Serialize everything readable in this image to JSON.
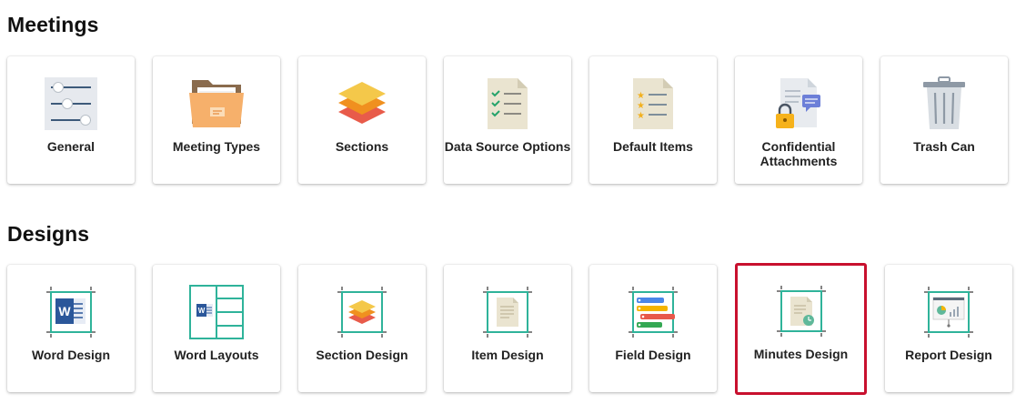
{
  "meetings": {
    "title": "Meetings",
    "items": [
      {
        "label": "General",
        "icon": "sliders-icon"
      },
      {
        "label": "Meeting Types",
        "icon": "folder-icon"
      },
      {
        "label": "Sections",
        "icon": "layers-icon"
      },
      {
        "label": "Data Source Options",
        "icon": "checklist-document-icon"
      },
      {
        "label": "Default Items",
        "icon": "starred-list-document-icon"
      },
      {
        "label": "Confidential Attachments",
        "icon": "locked-document-icon"
      },
      {
        "label": "Trash Can",
        "icon": "trash-can-icon"
      }
    ]
  },
  "designs": {
    "title": "Designs",
    "items": [
      {
        "label": "Word Design",
        "icon": "word-design-icon"
      },
      {
        "label": "Word Layouts",
        "icon": "word-layouts-icon"
      },
      {
        "label": "Section Design",
        "icon": "section-design-icon"
      },
      {
        "label": "Item Design",
        "icon": "item-design-icon"
      },
      {
        "label": "Field Design",
        "icon": "field-design-icon"
      },
      {
        "label": "Minutes Design",
        "icon": "minutes-design-icon",
        "selected": true
      },
      {
        "label": "Report Design",
        "icon": "report-design-icon"
      }
    ]
  },
  "colors": {
    "selected_border": "#c8102e",
    "design_frame": "#2fb39a"
  }
}
